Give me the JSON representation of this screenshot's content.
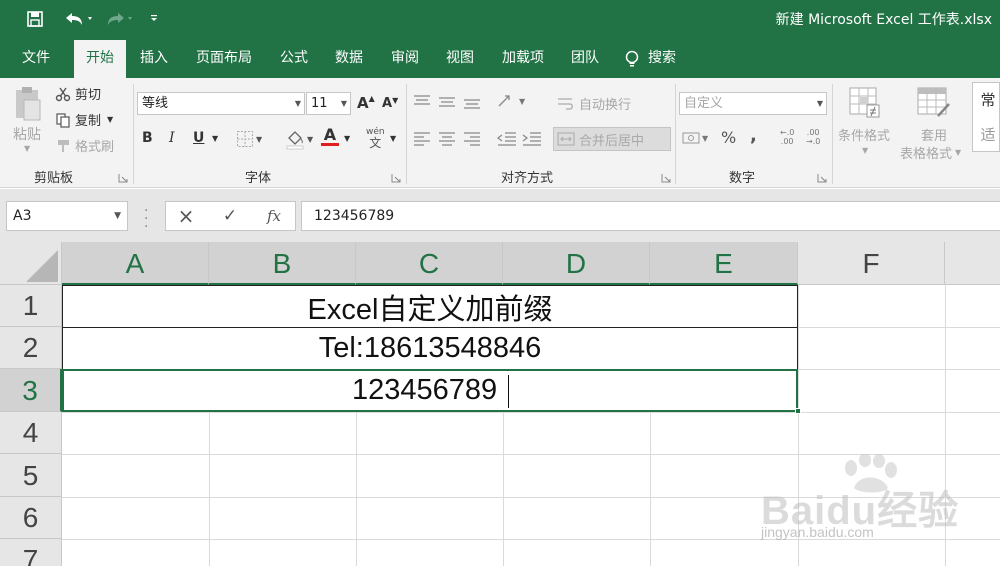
{
  "titlebar": {
    "doc_title": "新建 Microsoft Excel 工作表.xlsx",
    "accent": "#217346",
    "qat_icons": [
      "save-icon",
      "undo-icon",
      "redo-icon",
      "customize-qat-icon"
    ]
  },
  "tabs": {
    "file": "文件",
    "home": "开始",
    "insert": "插入",
    "page_layout": "页面布局",
    "formulas": "公式",
    "data": "数据",
    "review": "审阅",
    "view": "视图",
    "addins": "加载项",
    "team": "团队",
    "search": "搜索"
  },
  "ribbon": {
    "clipboard": {
      "paste": "粘贴",
      "cut": "剪切",
      "copy": "复制",
      "format_painter": "格式刷",
      "group_label": "剪贴板"
    },
    "font": {
      "font_name": "等线",
      "font_size": "11",
      "bold": "B",
      "italic": "I",
      "underline": "U",
      "font_color_letter": "A",
      "font_color": "#e02020",
      "phonetic": "wén",
      "group_label": "字体"
    },
    "alignment": {
      "wrap_text": "自动换行",
      "merge_center": "合并后居中",
      "group_label": "对齐方式"
    },
    "number": {
      "format": "自定义",
      "percent": "%",
      "comma": ",",
      "group_label": "数字"
    },
    "styles": {
      "conditional_formatting": "条件格式",
      "format_as_table_line1": "套用",
      "format_as_table_line2": "表格格式",
      "gallery_top": "常",
      "gallery_bottom": "适"
    }
  },
  "formula_bar": {
    "name_box": "A3",
    "formula": "123456789",
    "cancel_icon": "×",
    "enter_icon": "✓",
    "fx": "fx"
  },
  "sheet": {
    "columns": [
      "A",
      "B",
      "C",
      "D",
      "E",
      "F"
    ],
    "rows": [
      "1",
      "2",
      "3",
      "4",
      "5",
      "6",
      "7"
    ],
    "cells": {
      "r1": "Excel自定义加前缀",
      "r2": "Tel:18613548846",
      "r3": "123456789"
    },
    "selected_cell": "A3"
  },
  "watermark": {
    "brand": "Baidu经验",
    "url": "jingyan.baidu.com"
  }
}
